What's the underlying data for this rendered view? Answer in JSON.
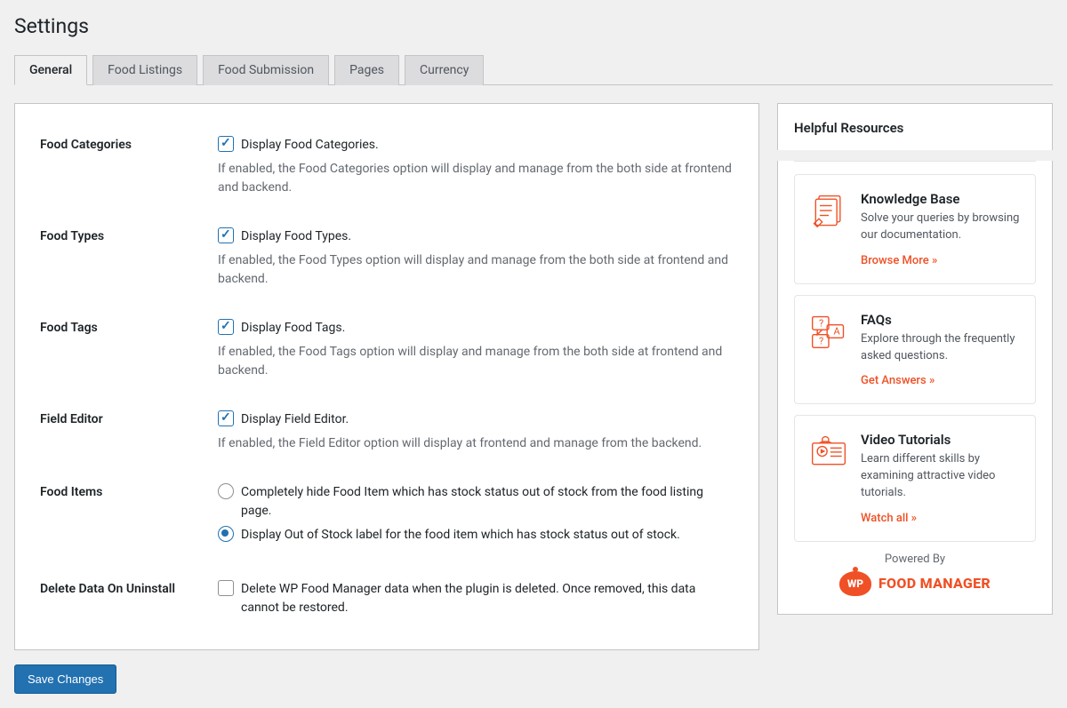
{
  "page_title": "Settings",
  "tabs": [
    "General",
    "Food Listings",
    "Food Submission",
    "Pages",
    "Currency"
  ],
  "active_tab": 0,
  "settings": [
    {
      "label": "Food Categories",
      "checkbox_label": "Display Food Categories.",
      "checked": true,
      "help": "If enabled, the Food Categories option will display and manage from the both side at frontend and backend."
    },
    {
      "label": "Food Types",
      "checkbox_label": "Display Food Types.",
      "checked": true,
      "help": "If enabled, the Food Types option will display and manage from the both side at frontend and backend."
    },
    {
      "label": "Food Tags",
      "checkbox_label": "Display Food Tags.",
      "checked": true,
      "help": "If enabled, the Food Tags option will display and manage from the both side at frontend and backend."
    },
    {
      "label": "Field Editor",
      "checkbox_label": "Display Field Editor.",
      "checked": true,
      "help": "If enabled, the Field Editor option will display at frontend and manage from the backend."
    }
  ],
  "food_items": {
    "label": "Food Items",
    "options": [
      "Completely hide Food Item which has stock status out of stock from the food listing page.",
      "Display Out of Stock label for the food item which has stock status out of stock."
    ],
    "selected": 1
  },
  "delete_data": {
    "label": "Delete Data On Uninstall",
    "checkbox_label": "Delete WP Food Manager data when the plugin is deleted. Once removed, this data cannot be restored.",
    "checked": false
  },
  "save_button": "Save Changes",
  "sidebar": {
    "title": "Helpful Resources",
    "cards": [
      {
        "title": "Knowledge Base",
        "desc": "Solve your queries by browsing our documentation.",
        "link": "Browse More"
      },
      {
        "title": "FAQs",
        "desc": "Explore through the frequently asked questions.",
        "link": "Get Answers"
      },
      {
        "title": "Video Tutorials",
        "desc": "Learn different skills by examining attractive video tutorials.",
        "link": "Watch all"
      }
    ],
    "powered_by": "Powered By",
    "brand_badge": "WP",
    "brand_name": "FOOD MANAGER"
  }
}
